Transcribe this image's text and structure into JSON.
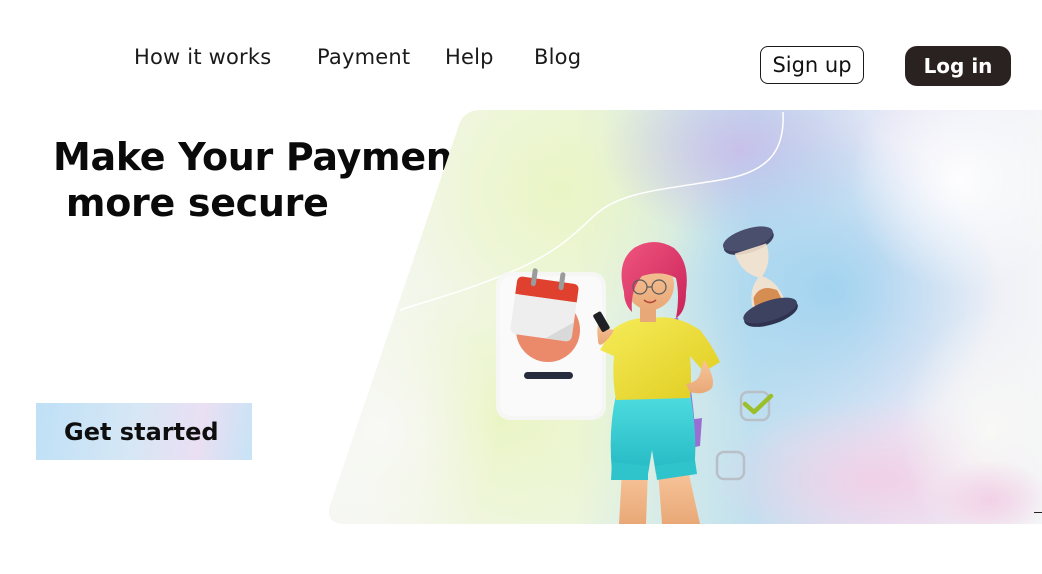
{
  "nav": {
    "items": [
      {
        "label": "How it  works"
      },
      {
        "label": "Payment"
      },
      {
        "label": "Help"
      },
      {
        "label": "Blog"
      }
    ],
    "signup_label": "Sign up",
    "login_label": "Log in"
  },
  "hero": {
    "title_line1": "Make Your Payment",
    "title_line2": " more secure",
    "cta_label": "Get started"
  },
  "colors": {
    "login_bg": "#2a2220",
    "text": "#0a0a0a",
    "calendar_red": "#e0412f",
    "shirt_yellow": "#f2e23a",
    "shorts_cyan": "#3fd2d8",
    "hair_pink": "#e83a6e"
  },
  "icons": [
    "calendar-icon",
    "hourglass-icon",
    "checkbox-checked-icon",
    "checkbox-empty-icon"
  ]
}
